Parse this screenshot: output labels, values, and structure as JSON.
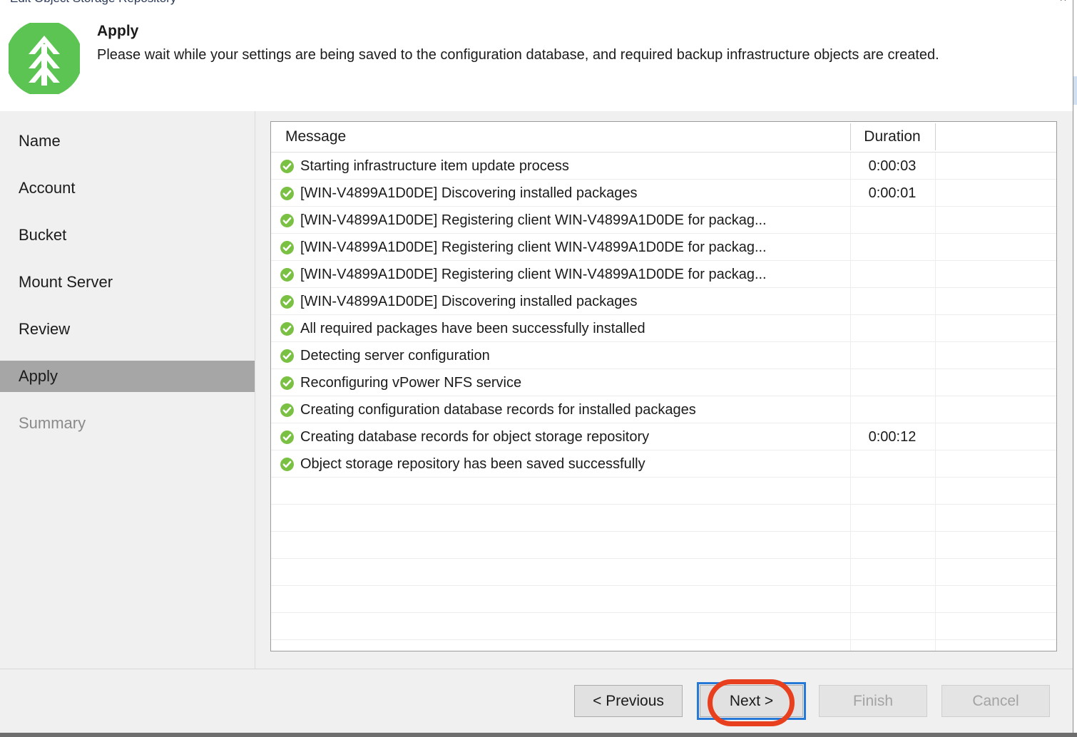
{
  "window": {
    "title": "Edit Object Storage Repository",
    "buttons": [
      "minimize",
      "close"
    ]
  },
  "header": {
    "logo_icon": "veeam-logo-icon",
    "logo_color": "#5bc453",
    "title": "Apply",
    "description": "Please wait while your settings are being saved to the configuration database, and required backup infrastructure objects are created."
  },
  "sidebar": {
    "items": [
      {
        "label": "Name",
        "state": "normal"
      },
      {
        "label": "Account",
        "state": "normal"
      },
      {
        "label": "Bucket",
        "state": "normal"
      },
      {
        "label": "Mount Server",
        "state": "normal"
      },
      {
        "label": "Review",
        "state": "normal"
      },
      {
        "label": "Apply",
        "state": "selected"
      },
      {
        "label": "Summary",
        "state": "disabled"
      }
    ],
    "selected_color": "#a6a6a6"
  },
  "log_table": {
    "columns": [
      "Message",
      "Duration"
    ],
    "status_icon": "success-check-icon",
    "status_color": "#7ac143",
    "rows": [
      {
        "message": "Starting infrastructure item update process",
        "duration": "0:00:03"
      },
      {
        "message": "[WIN-V4899A1D0DE] Discovering installed packages",
        "duration": "0:00:01"
      },
      {
        "message": "[WIN-V4899A1D0DE] Registering client WIN-V4899A1D0DE for packag...",
        "duration": ""
      },
      {
        "message": "[WIN-V4899A1D0DE] Registering client WIN-V4899A1D0DE for packag...",
        "duration": ""
      },
      {
        "message": "[WIN-V4899A1D0DE] Registering client WIN-V4899A1D0DE for packag...",
        "duration": ""
      },
      {
        "message": "[WIN-V4899A1D0DE] Discovering installed packages",
        "duration": ""
      },
      {
        "message": "All required packages have been successfully installed",
        "duration": ""
      },
      {
        "message": "Detecting server configuration",
        "duration": ""
      },
      {
        "message": "Reconfiguring vPower NFS service",
        "duration": ""
      },
      {
        "message": "Creating configuration database records for installed packages",
        "duration": ""
      },
      {
        "message": "Creating database records for object storage repository",
        "duration": "0:00:12"
      },
      {
        "message": "Object storage repository has been saved successfully",
        "duration": ""
      }
    ],
    "empty_row_count": 7
  },
  "footer": {
    "previous_label": "< Previous",
    "next_label": "Next >",
    "finish_label": "Finish",
    "cancel_label": "Cancel",
    "focused_button": "Next >",
    "disabled_buttons": [
      "Finish",
      "Cancel"
    ]
  },
  "annotation": {
    "shape": "oval",
    "color": "#e8401f",
    "target": "Next >"
  }
}
